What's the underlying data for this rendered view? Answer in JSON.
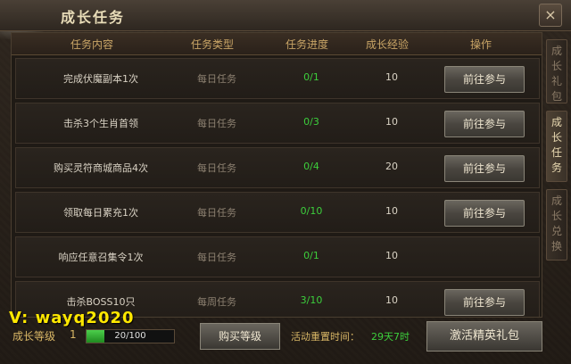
{
  "window": {
    "title": "成长任务",
    "close_label": "×"
  },
  "table": {
    "headers": [
      "任务内容",
      "任务类型",
      "任务进度",
      "成长经验",
      "操作"
    ],
    "rows": [
      {
        "name": "完成伏魔副本1次",
        "type": "每日任务",
        "progress": "0/1",
        "exp": "10",
        "action": "前往参与"
      },
      {
        "name": "击杀3个生肖首领",
        "type": "每日任务",
        "progress": "0/3",
        "exp": "10",
        "action": "前往参与"
      },
      {
        "name": "购买灵符商城商品4次",
        "type": "每日任务",
        "progress": "0/4",
        "exp": "20",
        "action": "前往参与"
      },
      {
        "name": "领取每日累充1次",
        "type": "每日任务",
        "progress": "0/10",
        "exp": "10",
        "action": "前往参与"
      },
      {
        "name": "响应任意召集令1次",
        "type": "每日任务",
        "progress": "0/1",
        "exp": "10",
        "action": ""
      },
      {
        "name": "击杀BOSS10只",
        "type": "每周任务",
        "progress": "3/10",
        "exp": "10",
        "action": "前往参与"
      }
    ]
  },
  "side_tabs": [
    {
      "label": "成长礼包",
      "active": false
    },
    {
      "label": "成长任务",
      "active": true
    },
    {
      "label": "成长兑换",
      "active": false
    }
  ],
  "bottom": {
    "watermark": "V: wayq2020",
    "level_label": "成长等级",
    "level_value": "1",
    "exp_text": "20/100",
    "exp_fraction": 0.2,
    "buy_label": "购买等级",
    "reset_label": "活动重置时间：",
    "reset_value": "29天7时",
    "activate_label": "激活精英礼包"
  }
}
